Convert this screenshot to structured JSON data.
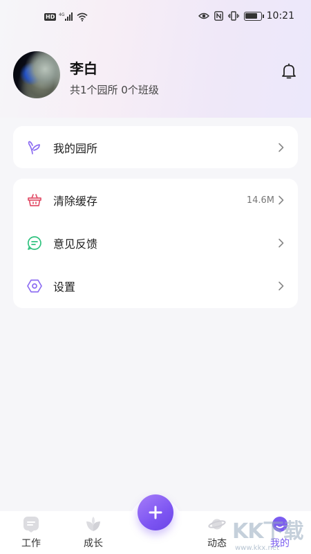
{
  "status_bar": {
    "network_badge": "HD",
    "network_type": "4G",
    "time": "10:21"
  },
  "profile": {
    "name": "李白",
    "summary": "共1个园所 0个班级"
  },
  "menu_card_1": {
    "items": [
      {
        "label": "我的园所",
        "icon": "sprout-icon"
      }
    ]
  },
  "menu_card_2": {
    "items": [
      {
        "label": "清除缓存",
        "value": "14.6M",
        "icon": "basket-icon"
      },
      {
        "label": "意见反馈",
        "icon": "feedback-icon"
      },
      {
        "label": "设置",
        "icon": "settings-hexagon-icon"
      }
    ]
  },
  "bottom_nav": {
    "items": [
      {
        "label": "工作",
        "icon": "work-icon"
      },
      {
        "label": "成长",
        "icon": "leaf-icon"
      },
      {
        "label": "动态",
        "icon": "planet-icon"
      },
      {
        "label": "我的",
        "icon": "profile-icon",
        "active": true
      }
    ],
    "fab_icon": "plus-icon"
  },
  "watermark": {
    "text": "KK下载",
    "url": "www.kkx.net"
  },
  "colors": {
    "accent": "#7b5cf0",
    "basket_icon": "#e2506a",
    "feedback_icon": "#2fc27e",
    "settings_icon": "#8c6cf2"
  }
}
